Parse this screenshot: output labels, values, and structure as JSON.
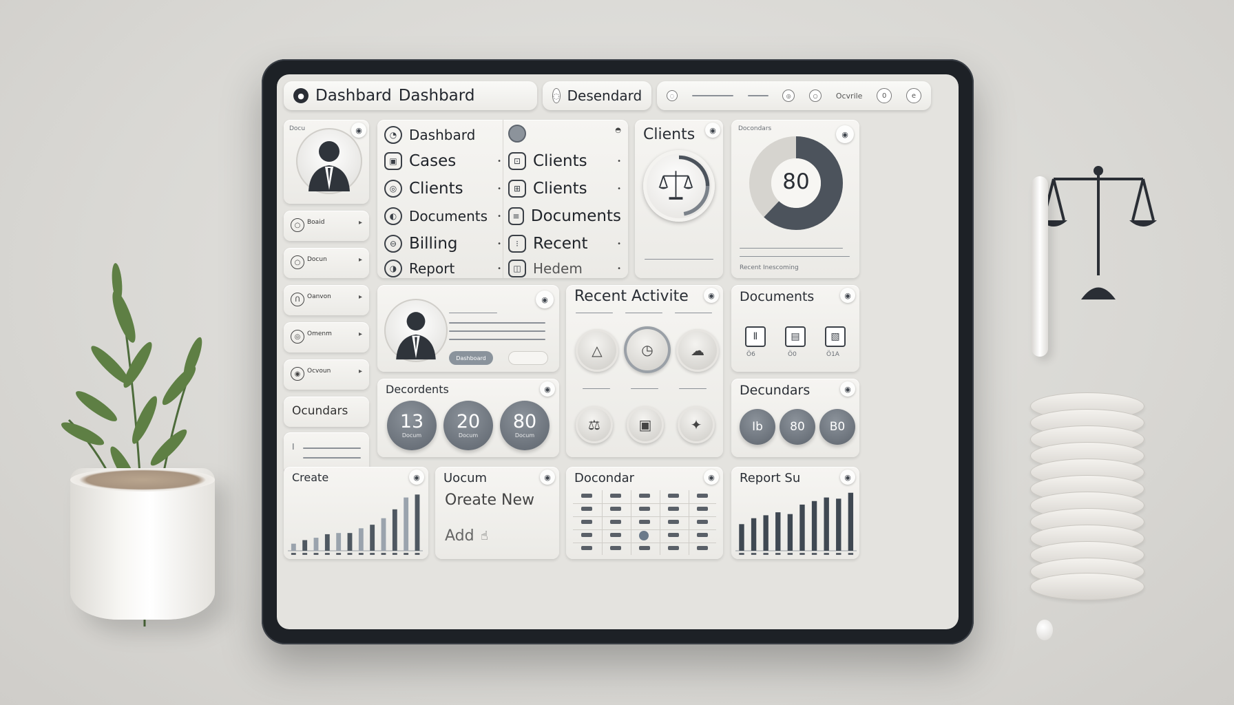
{
  "topbar": {
    "title_a": "Dashbard",
    "title_b": "Dashbard",
    "tab2": "Desendard",
    "tab3_small": "Ocvrile"
  },
  "profile": {
    "label": "Docu"
  },
  "side_items": [
    {
      "label": "Boaid"
    },
    {
      "label": "Docun"
    },
    {
      "label": "Oanvon"
    },
    {
      "label": "Omenm"
    },
    {
      "label": "Ocvoun"
    },
    {
      "label": "Ocundars"
    }
  ],
  "menu_left": [
    {
      "label": "Dashbard"
    },
    {
      "label": "Cases"
    },
    {
      "label": "Clients"
    },
    {
      "label": "Documents"
    },
    {
      "label": "Billing"
    },
    {
      "label": "Report"
    }
  ],
  "menu_right": [
    {
      "label": ""
    },
    {
      "label": "Clients"
    },
    {
      "label": "Clients"
    },
    {
      "label": "Documents"
    },
    {
      "label": "Recent"
    },
    {
      "label": "Hedem"
    }
  ],
  "clients_card": {
    "title": "Clients"
  },
  "donut_card": {
    "title": "Docondars",
    "value": "80",
    "donut_fill": 0.62,
    "footer": "Recent Inescoming"
  },
  "recent_activity": {
    "title": "Recent Activite"
  },
  "documents_card": {
    "title": "Documents",
    "labels": [
      "Ö6",
      "Ö0",
      "Ö1A"
    ]
  },
  "profile_card": {
    "button": "Dashboard"
  },
  "decordents": {
    "title": "Decordents",
    "stats": [
      {
        "num": "13",
        "cap": "Docum"
      },
      {
        "num": "20",
        "cap": "Docum"
      },
      {
        "num": "80",
        "cap": "Docum"
      }
    ]
  },
  "decundars": {
    "title": "Decundars",
    "stats": [
      "Ib",
      "80",
      "B0"
    ]
  },
  "create_card": {
    "title": "Create",
    "bars": [
      0.12,
      0.18,
      0.22,
      0.28,
      0.3,
      0.3,
      0.38,
      0.44,
      0.55,
      0.7,
      0.9,
      0.95
    ]
  },
  "uocum_card": {
    "title": "Uocum",
    "subtitle": "Oreate New",
    "add": "Add"
  },
  "docondar_card": {
    "title": "Docondar"
  },
  "report_card": {
    "title": "Report Su",
    "bars": [
      0.45,
      0.55,
      0.6,
      0.65,
      0.62,
      0.78,
      0.84,
      0.9,
      0.88,
      0.98
    ]
  },
  "colors": {
    "accent": "#5d646d",
    "dark": "#2a2e35"
  }
}
